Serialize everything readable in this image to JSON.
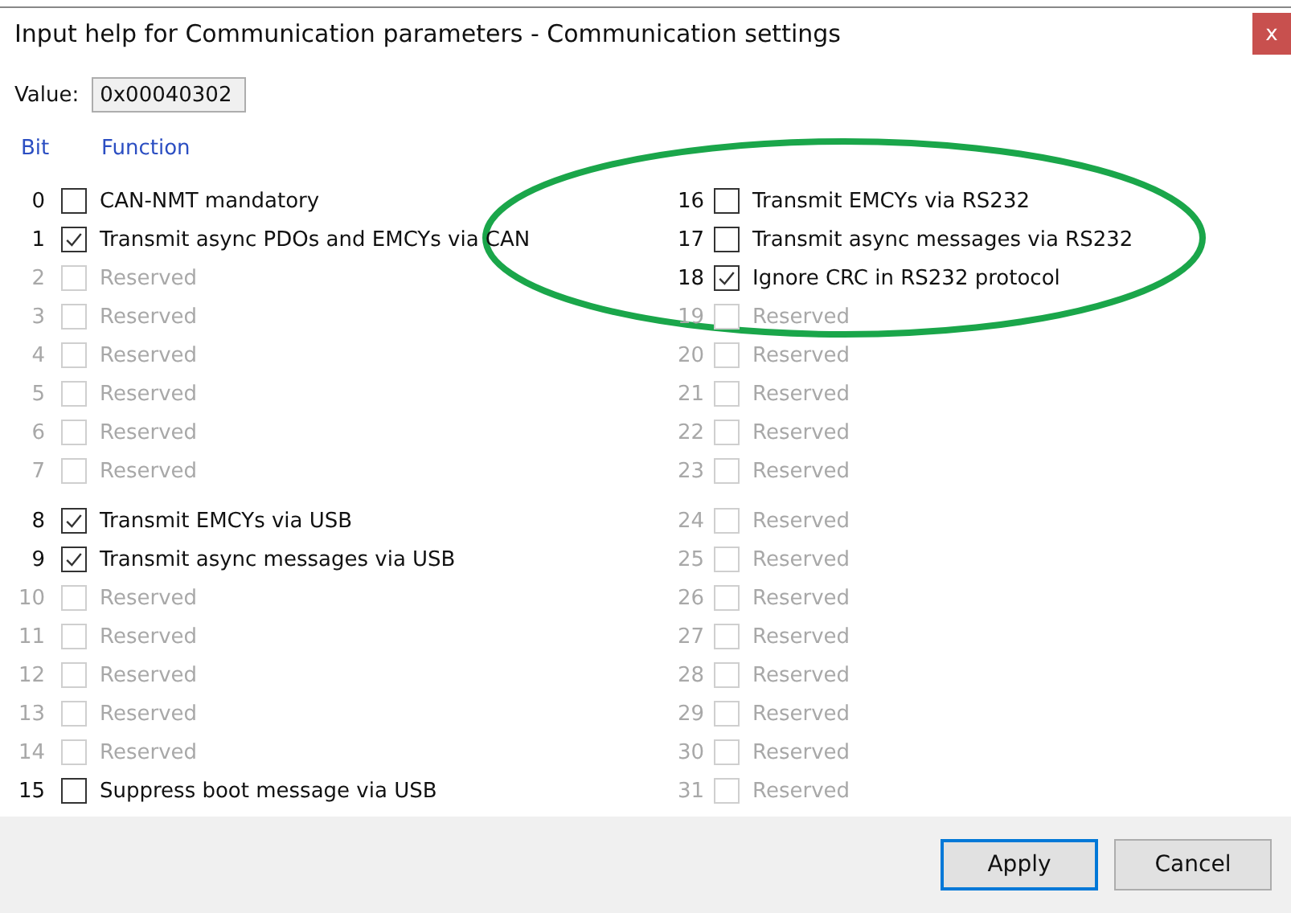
{
  "window": {
    "title": "Input help for Communication parameters - Communication settings",
    "close": "x"
  },
  "value": {
    "label": "Value:",
    "text": "0x00040302"
  },
  "headers": {
    "bit": "Bit",
    "function": "Function"
  },
  "columns": [
    {
      "groups": [
        [
          {
            "bit": "0",
            "label": "CAN-NMT mandatory",
            "checked": false,
            "disabled": false
          },
          {
            "bit": "1",
            "label": "Transmit async PDOs and EMCYs via CAN",
            "checked": true,
            "disabled": false
          },
          {
            "bit": "2",
            "label": "Reserved",
            "checked": false,
            "disabled": true
          },
          {
            "bit": "3",
            "label": "Reserved",
            "checked": false,
            "disabled": true
          },
          {
            "bit": "4",
            "label": "Reserved",
            "checked": false,
            "disabled": true
          },
          {
            "bit": "5",
            "label": "Reserved",
            "checked": false,
            "disabled": true
          },
          {
            "bit": "6",
            "label": "Reserved",
            "checked": false,
            "disabled": true
          },
          {
            "bit": "7",
            "label": "Reserved",
            "checked": false,
            "disabled": true
          }
        ],
        [
          {
            "bit": "8",
            "label": "Transmit EMCYs via USB",
            "checked": true,
            "disabled": false
          },
          {
            "bit": "9",
            "label": "Transmit async messages via USB",
            "checked": true,
            "disabled": false
          },
          {
            "bit": "10",
            "label": "Reserved",
            "checked": false,
            "disabled": true
          },
          {
            "bit": "11",
            "label": "Reserved",
            "checked": false,
            "disabled": true
          },
          {
            "bit": "12",
            "label": "Reserved",
            "checked": false,
            "disabled": true
          },
          {
            "bit": "13",
            "label": "Reserved",
            "checked": false,
            "disabled": true
          },
          {
            "bit": "14",
            "label": "Reserved",
            "checked": false,
            "disabled": true
          },
          {
            "bit": "15",
            "label": "Suppress boot message via USB",
            "checked": false,
            "disabled": false
          }
        ]
      ]
    },
    {
      "groups": [
        [
          {
            "bit": "16",
            "label": "Transmit EMCYs via RS232",
            "checked": false,
            "disabled": false
          },
          {
            "bit": "17",
            "label": "Transmit async messages via RS232",
            "checked": false,
            "disabled": false
          },
          {
            "bit": "18",
            "label": "Ignore CRC in RS232 protocol",
            "checked": true,
            "disabled": false
          },
          {
            "bit": "19",
            "label": "Reserved",
            "checked": false,
            "disabled": true
          },
          {
            "bit": "20",
            "label": "Reserved",
            "checked": false,
            "disabled": true
          },
          {
            "bit": "21",
            "label": "Reserved",
            "checked": false,
            "disabled": true
          },
          {
            "bit": "22",
            "label": "Reserved",
            "checked": false,
            "disabled": true
          },
          {
            "bit": "23",
            "label": "Reserved",
            "checked": false,
            "disabled": true
          }
        ],
        [
          {
            "bit": "24",
            "label": "Reserved",
            "checked": false,
            "disabled": true
          },
          {
            "bit": "25",
            "label": "Reserved",
            "checked": false,
            "disabled": true
          },
          {
            "bit": "26",
            "label": "Reserved",
            "checked": false,
            "disabled": true
          },
          {
            "bit": "27",
            "label": "Reserved",
            "checked": false,
            "disabled": true
          },
          {
            "bit": "28",
            "label": "Reserved",
            "checked": false,
            "disabled": true
          },
          {
            "bit": "29",
            "label": "Reserved",
            "checked": false,
            "disabled": true
          },
          {
            "bit": "30",
            "label": "Reserved",
            "checked": false,
            "disabled": true
          },
          {
            "bit": "31",
            "label": "Reserved",
            "checked": false,
            "disabled": true
          }
        ]
      ]
    }
  ],
  "buttons": [
    {
      "label": "Apply",
      "selected": true
    },
    {
      "label": "Cancel",
      "selected": false
    }
  ]
}
